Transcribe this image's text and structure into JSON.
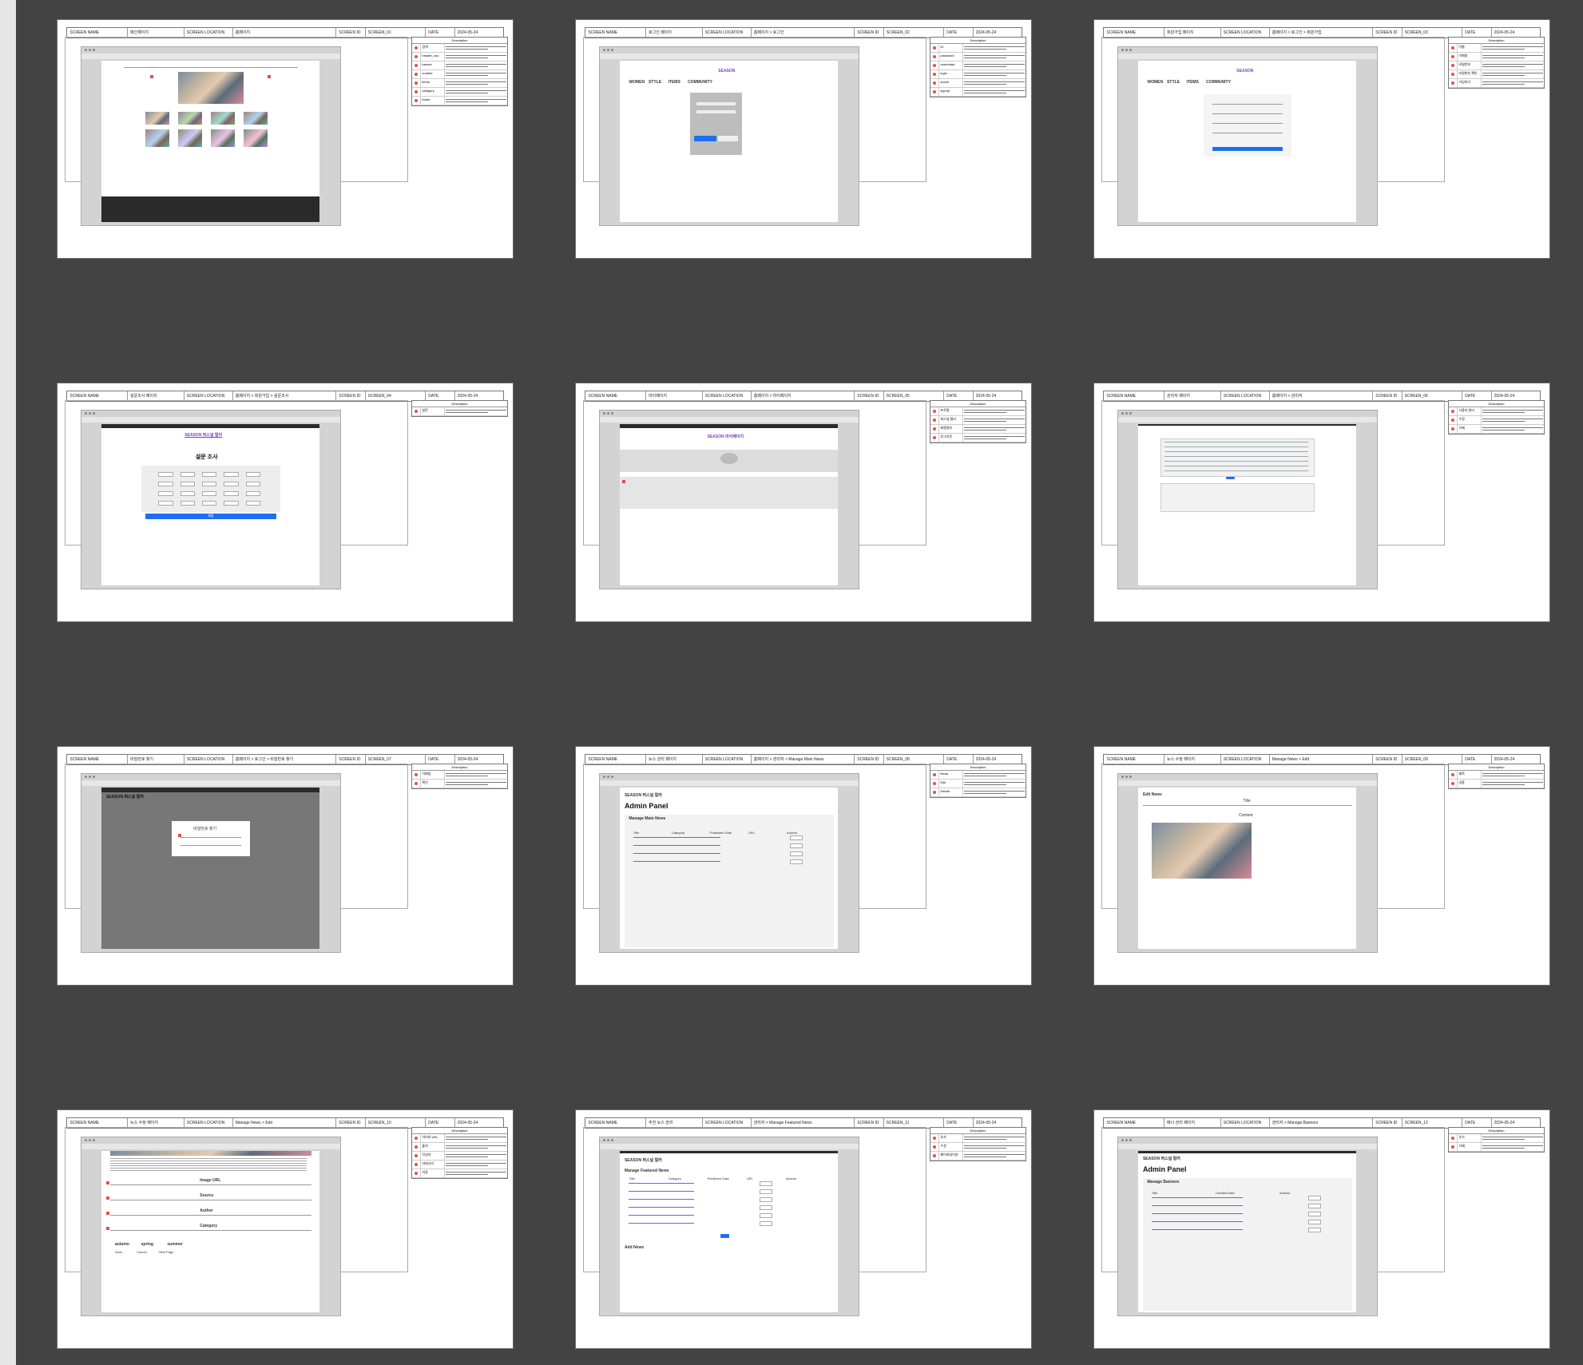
{
  "slides": [
    {
      "header": {
        "screen_name_label": "SCREEN NAME",
        "screen_name": "메인페이지",
        "screen_location_label": "SCREEN LOCATION",
        "screen_location": "홈페이지",
        "screen_id_label": "SCREEN ID",
        "screen_id": "SCREEN_01",
        "date_label": "DATE",
        "date": "2024-05-24"
      },
      "description": {
        "title": "Description",
        "rows": [
          {
            "key": "검색"
          },
          {
            "key": "header_nav"
          },
          {
            "key": "banner"
          },
          {
            "key": "content"
          },
          {
            "key": "items"
          },
          {
            "key": "category"
          },
          {
            "key": "footer"
          }
        ]
      }
    },
    {
      "header": {
        "screen_name_label": "SCREEN NAME",
        "screen_name": "로그인 페이지",
        "screen_location_label": "SCREEN LOCATION",
        "screen_location": "홈페이지 > 로그인",
        "screen_id_label": "SCREEN ID",
        "screen_id": "SCREEN_02",
        "date_label": "DATE",
        "date": "2024-05-24"
      },
      "description": {
        "title": "Description",
        "rows": [
          {
            "key": "ID"
          },
          {
            "key": "password"
          },
          {
            "key": "remember"
          },
          {
            "key": "login"
          },
          {
            "key": "social"
          },
          {
            "key": "signup"
          }
        ]
      },
      "page": {
        "logo": "SEASON",
        "nav": [
          "WOMEN",
          "STYLE",
          "ITEMS",
          "COMMUNITY"
        ]
      }
    },
    {
      "header": {
        "screen_name_label": "SCREEN NAME",
        "screen_name": "회원가입 페이지",
        "screen_location_label": "SCREEN LOCATION",
        "screen_location": "홈페이지 > 로그인 > 회원가입",
        "screen_id_label": "SCREEN ID",
        "screen_id": "SCREEN_03",
        "date_label": "DATE",
        "date": "2024-05-24"
      },
      "description": {
        "title": "Description",
        "rows": [
          {
            "key": "이름"
          },
          {
            "key": "이메일"
          },
          {
            "key": "비밀번호"
          },
          {
            "key": "비밀번호 확인"
          },
          {
            "key": "가입하기"
          }
        ]
      },
      "page": {
        "logo": "SEASON",
        "nav": [
          "WOMEN",
          "STYLE",
          "ITEMS",
          "COMMUNITY"
        ]
      }
    },
    {
      "header": {
        "screen_name_label": "SCREEN NAME",
        "screen_name": "설문조사 페이지",
        "screen_location_label": "SCREEN LOCATION",
        "screen_location": "홈페이지 > 회원가입 > 설문조사",
        "screen_id_label": "SCREEN ID",
        "screen_id": "SCREEN_04",
        "date_label": "DATE",
        "date": "2024-05-24"
      },
      "description": {
        "title": "Description",
        "rows": [
          {
            "key": "설문"
          }
        ]
      },
      "page": {
        "logo": "SEASON 퍼스널 컬러",
        "section": "설문 조사",
        "button": "제출"
      }
    },
    {
      "header": {
        "screen_name_label": "SCREEN NAME",
        "screen_name": "마이페이지",
        "screen_location_label": "SCREEN LOCATION",
        "screen_location": "홈페이지 > 마이페이지",
        "screen_id_label": "SCREEN ID",
        "screen_id": "SCREEN_05",
        "date_label": "DATE",
        "date": "2024-05-24"
      },
      "description": {
        "title": "Description",
        "rows": [
          {
            "key": "프로필"
          },
          {
            "key": "퍼스널 컬러"
          },
          {
            "key": "회원정보"
          },
          {
            "key": "로그아웃"
          }
        ]
      },
      "page": {
        "logo": "SEASON 마이페이지"
      }
    },
    {
      "header": {
        "screen_name_label": "SCREEN NAME",
        "screen_name": "관리자 페이지",
        "screen_location_label": "SCREEN LOCATION",
        "screen_location": "홈페이지 > 관리자",
        "screen_id_label": "SCREEN ID",
        "screen_id": "SCREEN_06",
        "date_label": "DATE",
        "date": "2024-05-24"
      },
      "description": {
        "title": "Description",
        "rows": [
          {
            "key": "사용자 관리"
          },
          {
            "key": "수정"
          },
          {
            "key": "삭제"
          }
        ]
      }
    },
    {
      "header": {
        "screen_name_label": "SCREEN NAME",
        "screen_name": "비밀번호 찾기",
        "screen_location_label": "SCREEN LOCATION",
        "screen_location": "홈페이지 > 로그인 > 비밀번호 찾기",
        "screen_id_label": "SCREEN ID",
        "screen_id": "SCREEN_07",
        "date_label": "DATE",
        "date": "2024-05-24"
      },
      "description": {
        "title": "Description",
        "rows": [
          {
            "key": "이메일"
          },
          {
            "key": "확인"
          }
        ]
      },
      "page": {
        "logo": "SEASON 퍼스널 컬러",
        "modal_title": "비밀번호 찾기"
      }
    },
    {
      "header": {
        "screen_name_label": "SCREEN NAME",
        "screen_name": "뉴스 관리 페이지",
        "screen_location_label": "SCREEN LOCATION",
        "screen_location": "홈페이지 > 관리자 > Manage Main News",
        "screen_id_label": "SCREEN ID",
        "screen_id": "SCREEN_08",
        "date_label": "DATE",
        "date": "2024-05-24"
      },
      "description": {
        "title": "Description",
        "rows": [
          {
            "key": "News"
          },
          {
            "key": "Edit"
          },
          {
            "key": "Delete"
          }
        ]
      },
      "page": {
        "logo": "SEASON 퍼스널 컬러",
        "title": "Admin Panel",
        "section": "Manage Main News",
        "columns": [
          "Title",
          "Category",
          "Published Date",
          "URL",
          "Actions"
        ],
        "row_count": 4
      }
    },
    {
      "header": {
        "screen_name_label": "SCREEN NAME",
        "screen_name": "뉴스 수정 페이지",
        "screen_location_label": "SCREEN LOCATION",
        "screen_location": "Manage News > Edit",
        "screen_id_label": "SCREEN ID",
        "screen_id": "SCREEN_09",
        "date_label": "DATE",
        "date": "2024-05-24"
      },
      "description": {
        "title": "Description",
        "rows": [
          {
            "key": "제목"
          },
          {
            "key": "내용"
          }
        ]
      },
      "page": {
        "title": "Edit News",
        "field_title": "Title",
        "field_content": "Content"
      }
    },
    {
      "header": {
        "screen_name_label": "SCREEN NAME",
        "screen_name": "뉴스 수정 페이지",
        "screen_location_label": "SCREEN LOCATION",
        "screen_location": "Manage News > Edit",
        "screen_id_label": "SCREEN ID",
        "screen_id": "SCREEN_10",
        "date_label": "DATE",
        "date": "2024-05-24"
      },
      "description": {
        "title": "Description",
        "rows": [
          {
            "key": "이미지 URL"
          },
          {
            "key": "출처"
          },
          {
            "key": "작성자"
          },
          {
            "key": "카테고리"
          },
          {
            "key": "저장"
          }
        ]
      },
      "page": {
        "labels": [
          "Image URL",
          "Source",
          "Author",
          "Category"
        ],
        "categories": [
          "autumn",
          "spring",
          "summer"
        ],
        "buttons": [
          "Save",
          "Cancel",
          "View Page"
        ]
      }
    },
    {
      "header": {
        "screen_name_label": "SCREEN NAME",
        "screen_name": "추천 뉴스 관리",
        "screen_location_label": "SCREEN LOCATION",
        "screen_location": "관리자 > Manage Featured News",
        "screen_id_label": "SCREEN ID",
        "screen_id": "SCREEN_11",
        "date_label": "DATE",
        "date": "2024-05-24"
      },
      "description": {
        "title": "Description",
        "rows": [
          {
            "key": "추가"
          },
          {
            "key": "수정"
          },
          {
            "key": "페이지네이션"
          }
        ]
      },
      "page": {
        "logo": "SEASON 퍼스널 컬러",
        "section": "Manage Featured News",
        "columns": [
          "Title",
          "Category",
          "Published Date",
          "URL",
          "Actions"
        ],
        "row_count": 6,
        "add_section": "Add News"
      }
    },
    {
      "header": {
        "screen_name_label": "SCREEN NAME",
        "screen_name": "배너 관리 페이지",
        "screen_location_label": "SCREEN LOCATION",
        "screen_location": "관리자 > Manage Banners",
        "screen_id_label": "SCREEN ID",
        "screen_id": "SCREEN_12",
        "date_label": "DATE",
        "date": "2024-05-24"
      },
      "description": {
        "title": "Description",
        "rows": [
          {
            "key": "추가"
          },
          {
            "key": "삭제"
          }
        ]
      },
      "page": {
        "logo": "SEASON 퍼스널 컬러",
        "title": "Admin Panel",
        "section": "Manage Banners",
        "columns": [
          "Title",
          "Created Date",
          "Actions"
        ],
        "row_count": 5
      }
    }
  ]
}
